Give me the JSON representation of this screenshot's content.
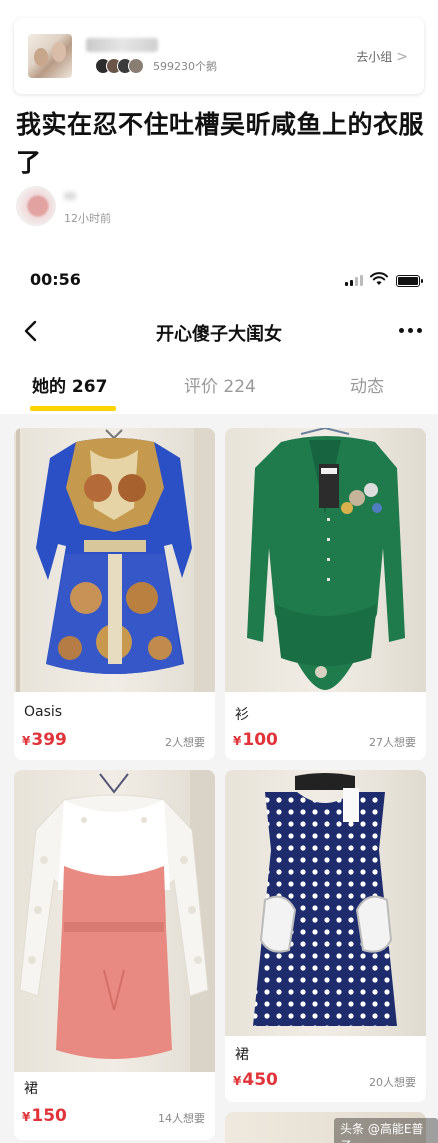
{
  "group": {
    "member_count": "599230个鹅",
    "goto_label": "去小组",
    "chevron": ">"
  },
  "post": {
    "title": "我实在忍不住吐槽吴昕咸鱼上的衣服了",
    "time": "12小时前"
  },
  "status_bar": {
    "time": "00:56"
  },
  "nav": {
    "title": "开心傻子大闺女"
  },
  "tabs": [
    {
      "label": "她的 267",
      "active": true
    },
    {
      "label": "评价 224",
      "active": false
    },
    {
      "label": "动态",
      "active": false
    }
  ],
  "products": [
    {
      "name": "Oasis",
      "currency": "¥",
      "price": "399",
      "wants": "2人想要"
    },
    {
      "name": "衫",
      "currency": "¥",
      "price": "100",
      "wants": "27人想要"
    },
    {
      "name": "裙",
      "currency": "¥",
      "price": "150",
      "wants": "14人想要"
    },
    {
      "name": "裙",
      "currency": "¥",
      "price": "450",
      "wants": "20人想要"
    }
  ],
  "watermark": "头条 @高能E普子",
  "colors": {
    "price": "#e0343a",
    "tab_indicator": "#ffd400",
    "background": "#f4f4f4"
  }
}
